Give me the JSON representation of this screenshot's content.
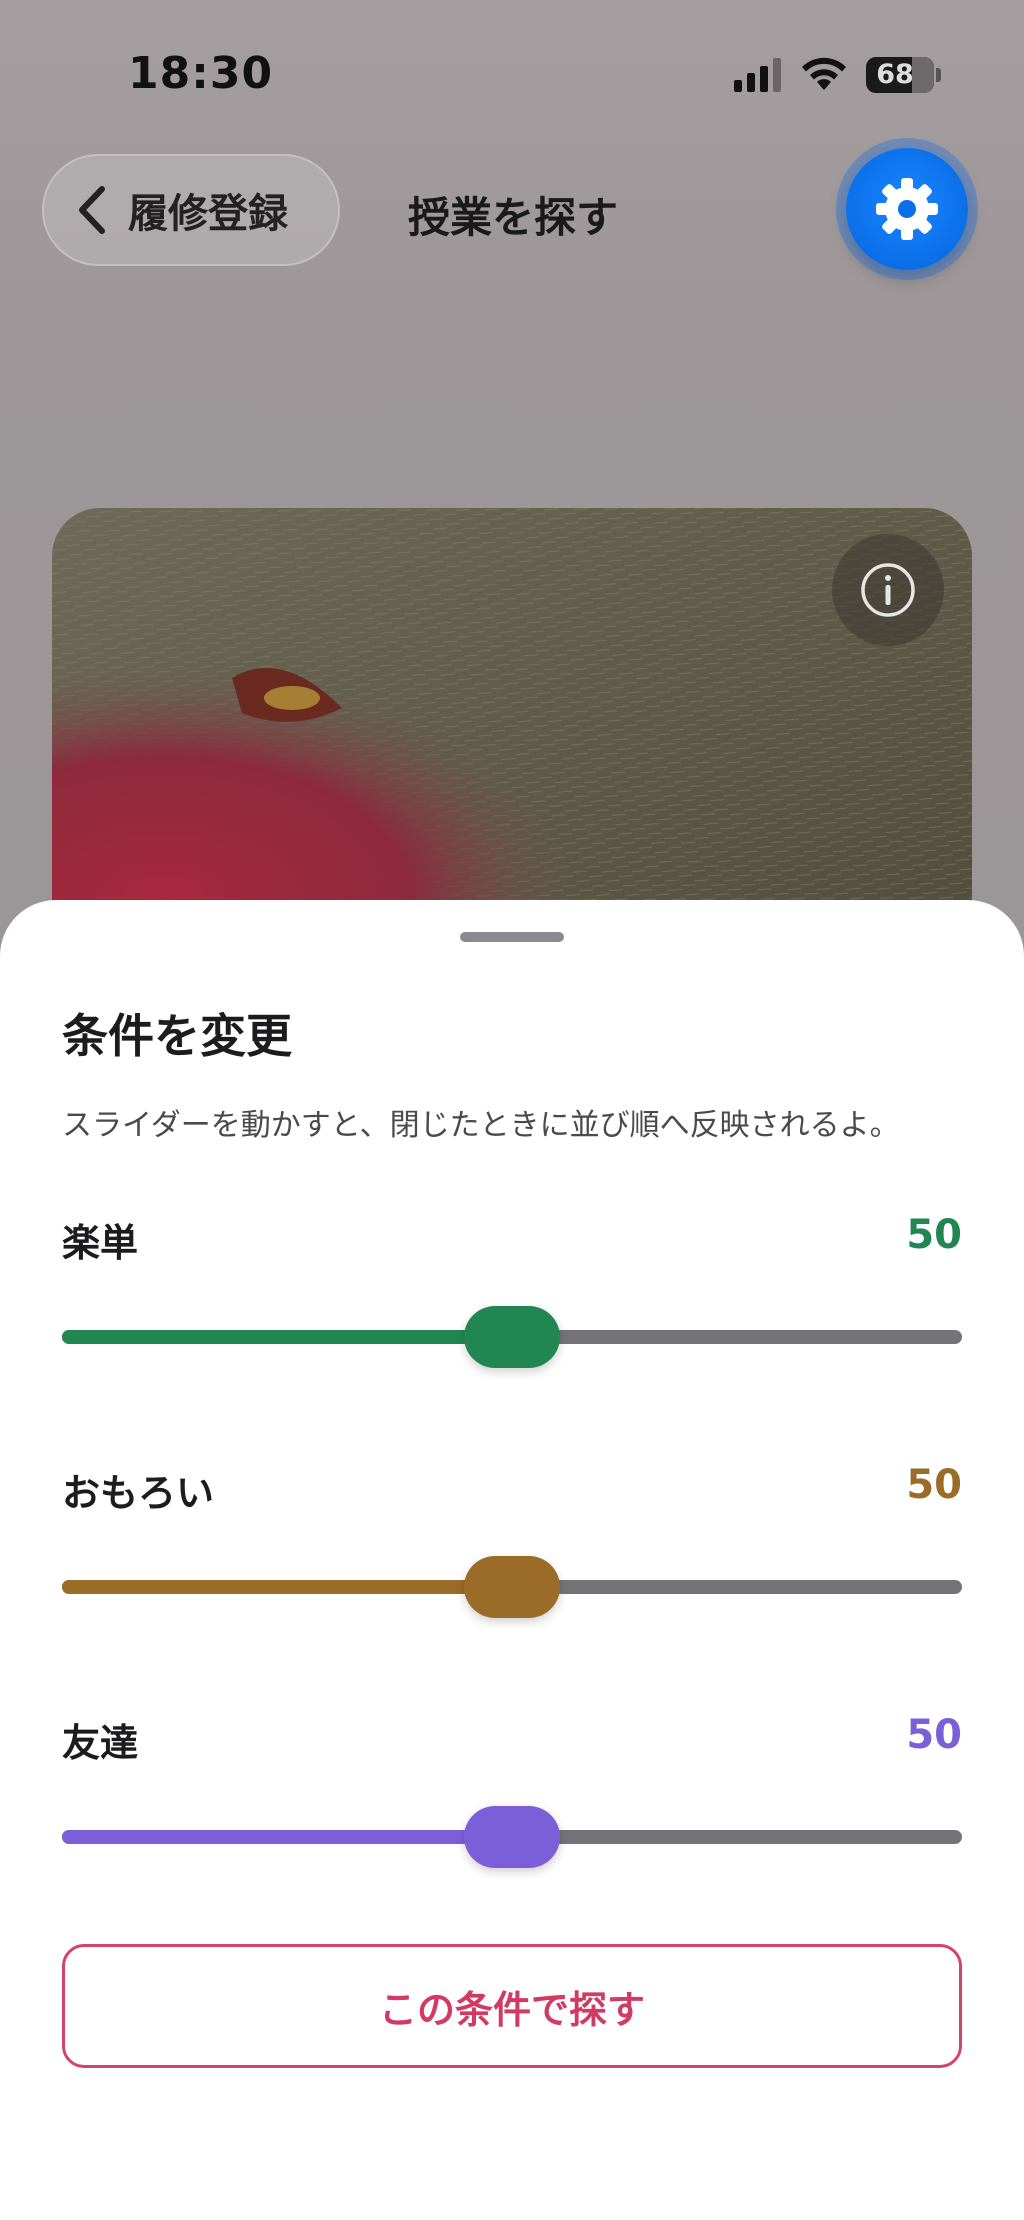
{
  "status_bar": {
    "time": "18:30",
    "battery": "68",
    "icons": [
      "signal-icon",
      "wifi-icon",
      "battery-icon"
    ]
  },
  "nav": {
    "back_label": "履修登録",
    "title": "授業を探す",
    "back_icon": "chevron-left-icon",
    "settings_icon": "gear-icon",
    "settings_color": "#0a6fe8"
  },
  "card": {
    "info_icon": "info-icon"
  },
  "sheet": {
    "title": "条件を変更",
    "subtitle": "スライダーを動かすと、閉じたときに並び順へ反映されるよ。",
    "sliders": [
      {
        "label": "楽単",
        "value": "50",
        "color": "#228653"
      },
      {
        "label": "おもろい",
        "value": "50",
        "color": "#9b6c28"
      },
      {
        "label": "友達",
        "value": "50",
        "color": "#7b5fd8"
      }
    ],
    "search_button": "この条件で探す",
    "accent": "#d23a64"
  }
}
